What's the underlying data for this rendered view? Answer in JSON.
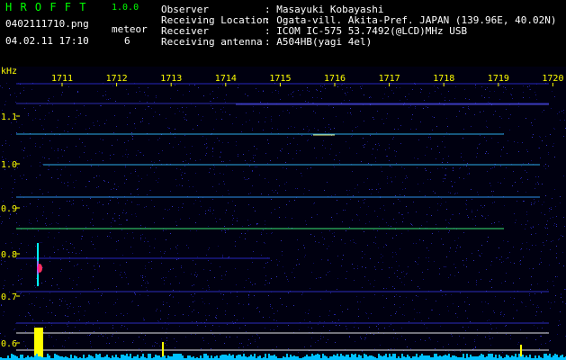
{
  "header": {
    "app_name": "H R O F F T",
    "version": "1.0.0",
    "filename": "0402111710.png",
    "datetime": "04.02.11 17:10",
    "counter_label": "meteor",
    "counter_value": "6",
    "fields": [
      {
        "label": "Observer",
        "value": ": Masayuki Kobayashi"
      },
      {
        "label": "Receiving Location",
        "value": ": Ogata-vill. Akita-Pref. JAPAN (139.96E, 40.02N)"
      },
      {
        "label": "Receiver",
        "value": ": ICOM IC-575 53.7492(@LCD)MHz USB"
      },
      {
        "label": "Receiving antenna",
        "value": ": A504HB(yagi 4el)"
      }
    ]
  },
  "spectrogram": {
    "unit_label": "kHz",
    "time_ticks": [
      "1711",
      "1712",
      "1713",
      "1714",
      "1715",
      "1716",
      "1717",
      "1718",
      "1719",
      "1720"
    ],
    "freq_ticks": [
      "1.1",
      "1.0",
      "0.9",
      "0.8",
      "0.7",
      "0.6"
    ],
    "colors": {
      "background": "#000010",
      "text": "#ffff00",
      "signal": "#00ffff",
      "level_bar": "#ffff00"
    }
  }
}
